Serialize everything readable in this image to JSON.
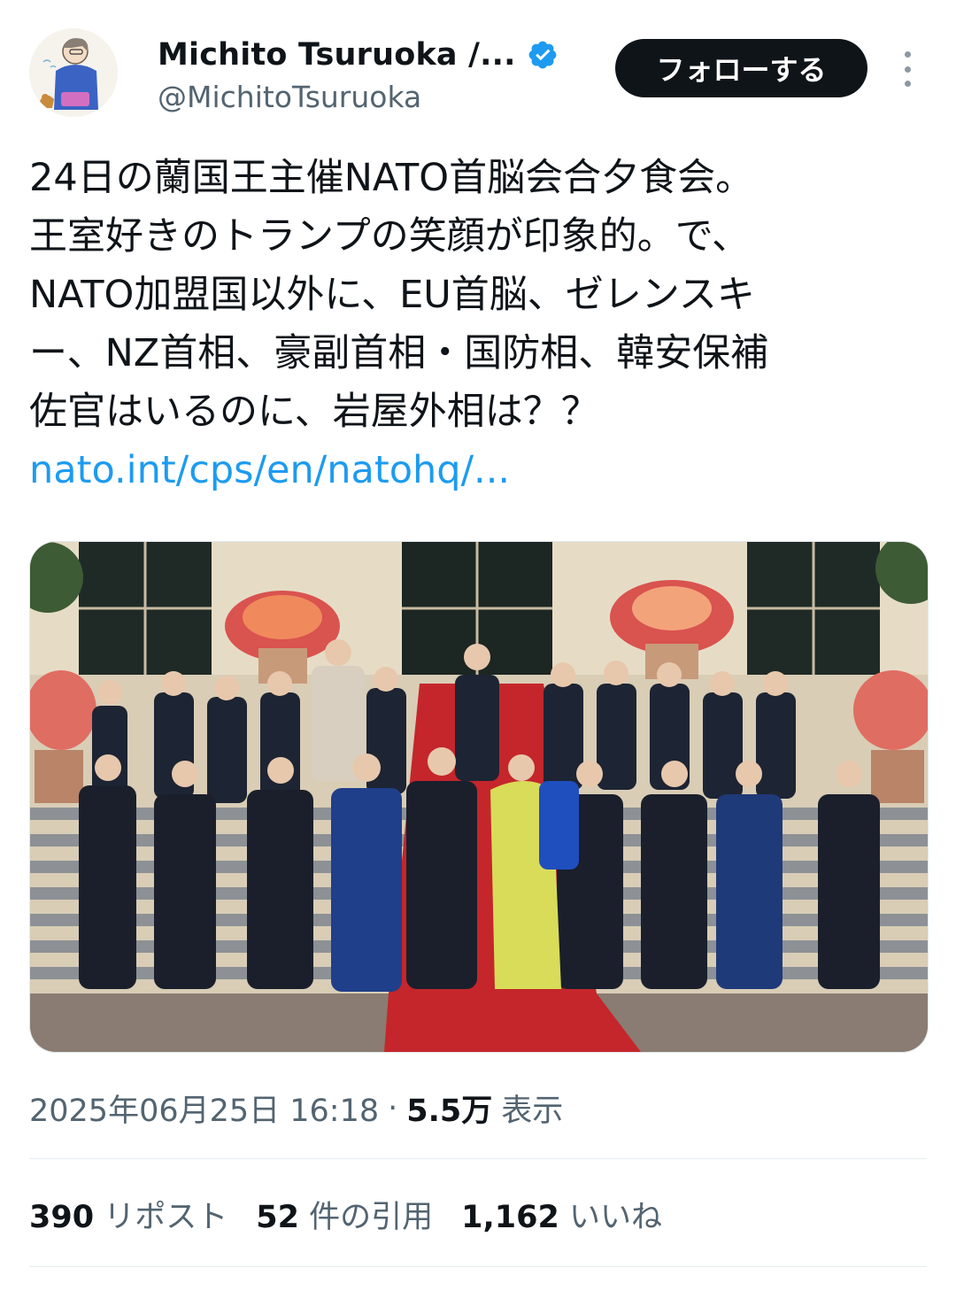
{
  "author": {
    "display_name": "Michito Tsuruoka /...",
    "handle": "@MichitoTsuruoka",
    "verified": true
  },
  "actions": {
    "follow_label": "フォローする"
  },
  "tweet": {
    "lines": [
      "24日の蘭国王主催NATO首脳会合夕食会。",
      "王室好きのトランプの笑顔が印象的。で、",
      "NATO加盟国以外に、EU首脳、ゼレンスキ",
      "ー、NZ首相、豪副首相・国防相、韓安保補",
      "佐官はいるのに、岩屋外相は？？"
    ],
    "link_text": "nato.int/cps/en/natohq/..."
  },
  "meta": {
    "timestamp": "2025年06月25日 16:18",
    "separator": "·",
    "views_count": "5.5万",
    "views_label": "表示"
  },
  "stats": {
    "reposts_count": "390",
    "reposts_label": "リポスト",
    "quotes_count": "52",
    "quotes_label": "件の引用",
    "likes_count": "1,162",
    "likes_label": "いいね"
  },
  "colors": {
    "link": "#1d9bf0",
    "verified": "#1d9bf0",
    "secondary_text": "#536471",
    "follow_button_bg": "#0f1419"
  }
}
